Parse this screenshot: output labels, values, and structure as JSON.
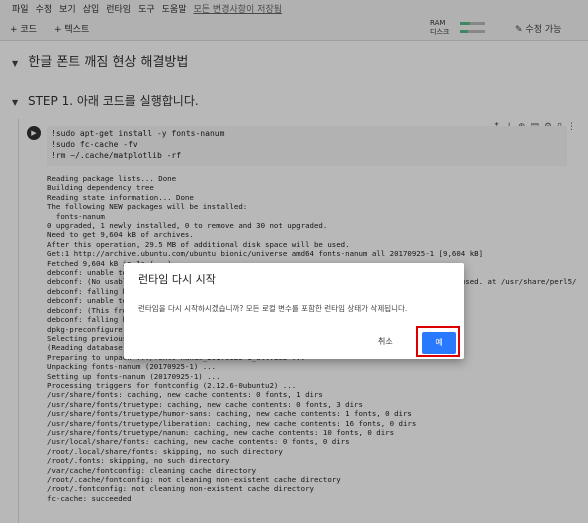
{
  "menu": {
    "items": [
      "파일",
      "수정",
      "보기",
      "삽입",
      "런타임",
      "도구",
      "도움말"
    ],
    "saved": "모든 변경사항이 저장됨"
  },
  "toolbar": {
    "add_code": "+ 코드",
    "add_text": "+ 텍스트",
    "ram_label": "RAM",
    "disk_label": "디스크",
    "edit_label": "수정 가능"
  },
  "main": {
    "title": "한글 폰트 깨짐 현상 해결방법",
    "step": "STEP 1. 아래 코드를 실행합니다."
  },
  "code": [
    "!sudo apt-get install -y fonts-nanum",
    "!sudo fc-cache -fv",
    "!rm ~/.cache/matplotlib -rf"
  ],
  "output_lines": [
    "Reading package lists... Done",
    "Building dependency tree",
    "Reading state information... Done",
    "The following NEW packages will be installed:",
    "  fonts-nanum",
    "0 upgraded, 1 newly installed, 0 to remove and 30 not upgraded.",
    "Need to get 9,604 kB of archives.",
    "After this operation, 29.5 MB of additional disk space will be used.",
    "Get:1 http://archive.ubuntu.com/ubuntu bionic/universe amd64 fonts-nanum all 20170925-1 [9,604 kB]",
    "Fetched 9,604 kB in 1s (...)",
    "debconf: unable to initialize frontend: Dialog",
    "debconf: (No usable dialog-like program is installed, so the dialog based frontend cannot be used. at /usr/share/perl5/",
    "debconf: falling back to frontend: Readline",
    "debconf: unable to initialize frontend: Readline",
    "debconf: (This frontend requires a controlling tty.)",
    "debconf: falling back to frontend: Teletype",
    "dpkg-preconfigure: unable to re-open stdin:",
    "Selecting previously unselected package fonts-nanum.",
    "(Reading database ... 144328 files and directories currently installed.)",
    "Preparing to unpack .../fonts-nanum_20170925-1_all.deb ...",
    "Unpacking fonts-nanum (20170925-1) ...",
    "Setting up fonts-nanum (20170925-1) ...",
    "Processing triggers for fontconfig (2.12.6-0ubuntu2) ...",
    "/usr/share/fonts: caching, new cache contents: 0 fonts, 1 dirs",
    "/usr/share/fonts/truetype: caching, new cache contents: 0 fonts, 3 dirs",
    "/usr/share/fonts/truetype/humor-sans: caching, new cache contents: 1 fonts, 0 dirs",
    "/usr/share/fonts/truetype/liberation: caching, new cache contents: 16 fonts, 0 dirs",
    "/usr/share/fonts/truetype/nanum: caching, new cache contents: 10 fonts, 0 dirs",
    "/usr/local/share/fonts: caching, new cache contents: 0 fonts, 0 dirs",
    "/root/.local/share/fonts: skipping, no such directory",
    "/root/.fonts: skipping, no such directory",
    "/var/cache/fontconfig: cleaning cache directory",
    "/root/.cache/fontconfig: not cleaning non-existent cache directory",
    "/root/.fontconfig: not cleaning non-existent cache directory",
    "fc-cache: succeeded"
  ],
  "dialog": {
    "title": "런타임 다시 시작",
    "message": "런타임을 다시 시작하시겠습니까? 모든 로컬 변수를 포함한 런타임 상태가 삭제됩니다.",
    "cancel": "취소",
    "ok": "예"
  },
  "colors": {
    "ok_button": "#2979ff",
    "highlight_border": "#dd0000"
  }
}
